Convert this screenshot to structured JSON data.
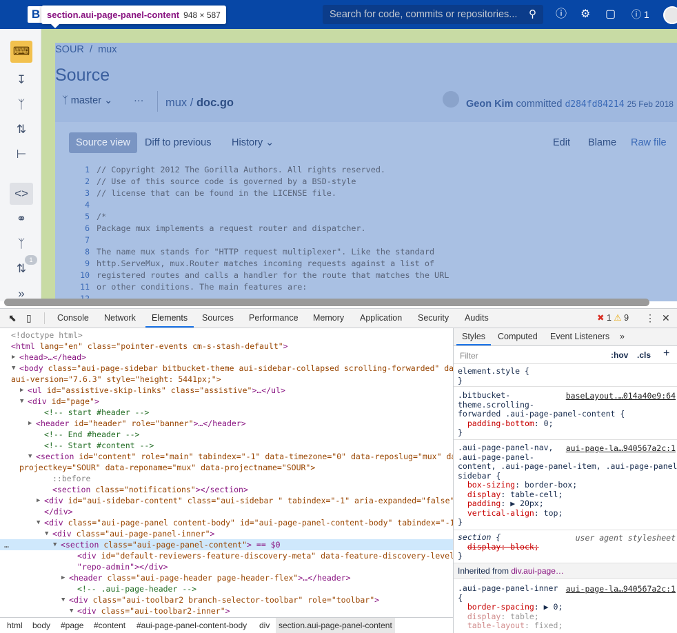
{
  "header": {
    "logo": "B",
    "search_placeholder": "Search for code, commits or repositories...",
    "notif_count": "1"
  },
  "tooltip": {
    "selector": "section.aui-page-panel-content",
    "size": "948 × 587"
  },
  "page": {
    "breadcrumb": [
      "SOUR",
      "/",
      "mux"
    ],
    "title": "Source",
    "branch": "master",
    "more": "···",
    "path_repo": "mux",
    "path_sep": " / ",
    "path_file": "doc.go",
    "author": "Geon Kim",
    "committed": "committed",
    "commit_hash": "d284fd84214",
    "date": "25 Feb 2018",
    "sidebar_badge": "1"
  },
  "tabs": {
    "source_view": "Source view",
    "diff": "Diff to previous",
    "history": "History",
    "edit": "Edit",
    "blame": "Blame",
    "raw": "Raw file"
  },
  "code": [
    {
      "n": "1",
      "t": "// Copyright 2012 The Gorilla Authors. All rights reserved."
    },
    {
      "n": "2",
      "t": "// Use of this source code is governed by a BSD-style"
    },
    {
      "n": "3",
      "t": "// license that can be found in the LICENSE file."
    },
    {
      "n": "4",
      "t": ""
    },
    {
      "n": "5",
      "t": "/*"
    },
    {
      "n": "6",
      "t": "Package mux implements a request router and dispatcher."
    },
    {
      "n": "7",
      "t": ""
    },
    {
      "n": "8",
      "t": "The name mux stands for \"HTTP request multiplexer\". Like the standard"
    },
    {
      "n": "9",
      "t": "http.ServeMux, mux.Router matches incoming requests against a list of"
    },
    {
      "n": "10",
      "t": "registered routes and calls a handler for the route that matches the URL"
    },
    {
      "n": "11",
      "t": "or other conditions. The main features are:"
    },
    {
      "n": "12",
      "t": ""
    }
  ],
  "devtools": {
    "tabs": [
      "Console",
      "Network",
      "Elements",
      "Sources",
      "Performance",
      "Memory",
      "Application",
      "Security",
      "Audits"
    ],
    "errors": "1",
    "warnings": "9",
    "breadcrumb": [
      "html",
      "body",
      "#page",
      "#content",
      "#aui-page-panel-content-body",
      "div",
      "section.aui-page-panel-content"
    ],
    "styles_tabs": [
      "Styles",
      "Computed",
      "Event Listeners",
      "»"
    ],
    "filter": "Filter",
    "hov": ":hov",
    "cls": ".cls",
    "styles": {
      "element_style": "element.style {",
      "close": "}",
      "r1_sel1": ".bitbucket-",
      "r1_sel2": "theme.scrolling-",
      "r1_sel3": "forwarded .aui-page-panel-content {",
      "r1_src": "baseLayout.…014a40e9:64",
      "r1_p1": "padding-bottom",
      "r1_v1": "0;",
      "r2_sel1": ".aui-page-panel-nav,",
      "r2_sel2": ".aui-page-panel-",
      "r2_sel3": "content, .aui-page-panel-item, .aui-page-panel-",
      "r2_sel4": "sidebar {",
      "r2_src": "aui-page-la…940567a2c:1",
      "r2_p1": "box-sizing",
      "r2_v1": "border-box;",
      "r2_p2": "display",
      "r2_v2": "table-cell;",
      "r2_p3": "padding",
      "r2_v3": "▶ 20px;",
      "r2_p4": "vertical-align",
      "r2_v4": "top;",
      "r3_sel": "section {",
      "r3_src": "user agent stylesheet",
      "r3_p1": "display: block;",
      "inherited": "Inherited from",
      "inherited_el": "div.aui-page…",
      "r4_sel": ".aui-page-panel-inner",
      "r4_open": "{",
      "r4_src": "aui-page-la…940567a2c:1",
      "r4_p1": "border-spacing",
      "r4_v1": "▶ 0;",
      "r4_p2": "display",
      "r4_v2": "table;",
      "r4_p3": "table-layout",
      "r4_v3": "fixed;"
    }
  },
  "dom": [
    {
      "i": 0,
      "g": "<!doctype html>"
    },
    {
      "i": 0,
      "t": "html",
      "a": " lang=\"en\" class=\"pointer-events cm-s-stash-default\"",
      "e": ">"
    },
    {
      "i": 1,
      "x": "▶",
      "t": "head",
      "e": ">…</head>"
    },
    {
      "i": 1,
      "x": "▼",
      "t": "body",
      "a": " class=\"aui-page-sidebar bitbucket-theme aui-sidebar-collapsed scrolling-forwarded\" data-",
      "e": ""
    },
    {
      "i": 0,
      "g": "aui-version=\"7.6.3\" style=\"height: 5441px;\">"
    },
    {
      "i": 2,
      "x": "▶",
      "t": "ul",
      "a": " id=\"assistive-skip-links\" class=\"assistive\"",
      "e": ">…</ul>"
    },
    {
      "i": 2,
      "x": "▼",
      "t": "div",
      "a": " id=\"page\"",
      "e": ">"
    },
    {
      "i": 4,
      "c": "<!-- start #header -->"
    },
    {
      "i": 3,
      "x": "▶",
      "t": "header",
      "a": " id=\"header\" role=\"banner\"",
      "e": ">…</header>"
    },
    {
      "i": 4,
      "c": "<!-- End #header -->"
    },
    {
      "i": 4,
      "c": "<!-- Start #content -->"
    },
    {
      "i": 3,
      "x": "▼",
      "t": "section",
      "a": " id=\"content\" role=\"main\" tabindex=\"-1\" data-timezone=\"0\" data-reposlug=\"mux\" data-",
      "e": ""
    },
    {
      "i": 1,
      "g": "projectkey=\"SOUR\" data-reponame=\"mux\" data-projectname=\"SOUR\">"
    },
    {
      "i": 5,
      "g": "::before"
    },
    {
      "i": 5,
      "t": "section",
      "a": " class=\"notifications\"",
      "e": "></section>"
    },
    {
      "i": 4,
      "x": "▶",
      "t": "div",
      "a": " id=\"aui-sidebar-content\" class=\"aui-sidebar \" tabindex=\"-1\" aria-expanded=\"false\"",
      "e": ">…"
    },
    {
      "i": 4,
      "t": "/div",
      "e": ">"
    },
    {
      "i": 4,
      "x": "▼",
      "t": "div",
      "a": " class=\"aui-page-panel content-body\" id=\"aui-page-panel-content-body\" tabindex=\"-1\"",
      "e": ">"
    },
    {
      "i": 5,
      "x": "▼",
      "t": "div",
      "a": " class=\"aui-page-panel-inner\"",
      "e": ">"
    },
    {
      "i": 6,
      "x": "▼",
      "t": "section",
      "a": " class=\"aui-page-panel-content\"",
      "e": "> == $0",
      "h": true
    },
    {
      "i": 8,
      "t": "div",
      "a": " id=\"default-reviewers-feature-discovery-meta\" data-feature-discovery-level=",
      "e": ""
    },
    {
      "i": 8,
      "g": "\"repo-admin\"></div>"
    },
    {
      "i": 7,
      "x": "▶",
      "t": "header",
      "a": " class=\"aui-page-header page-header-flex\"",
      "e": ">…</header>"
    },
    {
      "i": 8,
      "c": "<!-- .aui-page-header -->"
    },
    {
      "i": 7,
      "x": "▼",
      "t": "div",
      "a": " class=\"aui-toolbar2 branch-selector-toolbar\" role=\"toolbar\"",
      "e": ">"
    },
    {
      "i": 8,
      "x": "▼",
      "t": "div",
      "a": " class=\"aui-toolbar2-inner\"",
      "e": ">"
    }
  ]
}
